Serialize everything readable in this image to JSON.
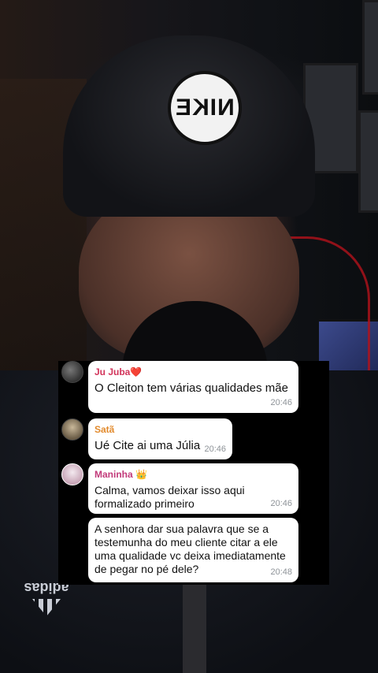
{
  "video": {
    "cap_logo_text": "NIKE",
    "shirt_brand": "adidas"
  },
  "chat": {
    "messages": [
      {
        "sender": "Ju Juba",
        "sender_badge": "❤️",
        "text": "O Cleiton tem várias qualidades mãe",
        "time": "20:46",
        "avatar": "ju-juba-avatar"
      },
      {
        "sender": "Satã",
        "text": "Ué Cite ai uma Júlia",
        "time": "20:46",
        "avatar": "sata-avatar"
      },
      {
        "sender": "Maninha",
        "sender_badge": "👑",
        "text": "Calma, vamos deixar isso aqui formalizado primeiro",
        "time": "20:46",
        "avatar": "maninha-avatar"
      },
      {
        "text": "A senhora dar sua palavra que se a testemunha do meu cliente citar a ele uma qualidade vc deixa imediatamente de pegar no pé dele?",
        "time": "20:48"
      }
    ]
  },
  "colors": {
    "bubble_bg": "#ffffff",
    "overlay_bg": "#000000",
    "sender_ju_juba": "#d2345a",
    "sender_sata": "#e28a2c",
    "sender_maninha": "#c23a7a",
    "timestamp": "#8e9398"
  }
}
